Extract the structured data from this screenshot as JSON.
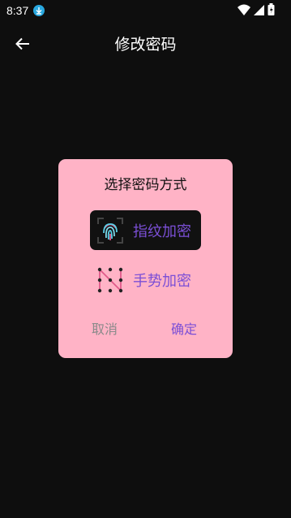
{
  "status_bar": {
    "time": "8:37",
    "download_icon": "download-icon",
    "icons": [
      "wifi-icon",
      "signal-icon",
      "battery-icon"
    ]
  },
  "app_bar": {
    "back_icon": "arrow-left-icon",
    "title": "修改密码"
  },
  "dialog": {
    "title": "选择密码方式",
    "options": [
      {
        "label": "指纹加密",
        "icon": "fingerprint-icon",
        "selected": true
      },
      {
        "label": "手势加密",
        "icon": "gesture-pattern-icon",
        "selected": false
      }
    ],
    "cancel_label": "取消",
    "confirm_label": "确定"
  },
  "colors": {
    "background": "#0e0e0e",
    "dialog_bg": "#ffb3c6",
    "accent": "#7b4fd6",
    "selected_bg": "#111111",
    "cancel_text": "#8a8a8a"
  }
}
